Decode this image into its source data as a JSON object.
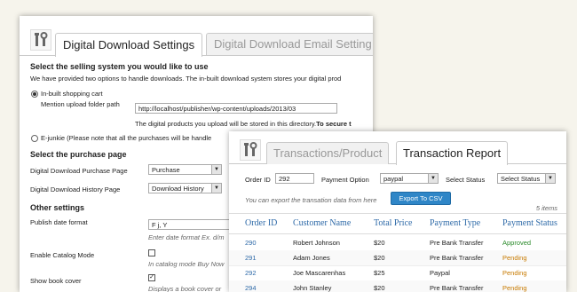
{
  "settings": {
    "tabs": [
      "Digital Download Settings",
      "Digital Download Email Setting"
    ],
    "selling": {
      "heading": "Select the selling system you would like to use",
      "desc": "We have provided two options to handle downloads. The in-built download system stores your digital prod",
      "option_inbuilt": "In-built shopping cart",
      "upload_label": "Mention upload folder path",
      "upload_value": "http://localhost/publisher/wp-content/uploads/2013/03",
      "stored_note": "The digital products you upload will be stored in this directory.",
      "stored_note_bold": "To secure t",
      "option_ejunkie": "E-junkie (Please note that all the purchases will be handle"
    },
    "purchase": {
      "heading": "Select the purchase page",
      "purchase_page_label": "Digital Download Purchase Page",
      "purchase_page_value": "Purchase",
      "history_page_label": "Digital Download History Page",
      "history_page_value": "Download History"
    },
    "other": {
      "heading": "Other settings",
      "date_label": "Publish date format",
      "date_value": "F j, Y",
      "date_hint": "Enter date format Ex. d/m",
      "catalog_label": "Enable Catalog Mode",
      "catalog_hint": "In catalog mode Buy Now",
      "cover_label": "Show book cover",
      "cover_hint": "Displays a book cover or"
    }
  },
  "report": {
    "tabs": [
      "Transactions/Product",
      "Transaction Report"
    ],
    "filters": {
      "order_id_label": "Order ID",
      "order_id_value": "292",
      "payment_option_label": "Payment Option",
      "payment_option_value": "paypal",
      "status_label": "Select Status",
      "status_value": "Select Status"
    },
    "export_note": "You can export the transation data from here",
    "export_button": "Export To CSV",
    "items_count": "5 items",
    "columns": [
      "Order ID",
      "Customer Name",
      "Total Price",
      "Payment Type",
      "Payment Status"
    ],
    "rows": [
      {
        "id": "290",
        "name": "Robert Johnson",
        "price": "$20",
        "type": "Pre Bank Transfer",
        "status": "Approved"
      },
      {
        "id": "291",
        "name": "Adam Jones",
        "price": "$20",
        "type": "Pre Bank Transfer",
        "status": "Pending"
      },
      {
        "id": "292",
        "name": "Joe Mascarenhas",
        "price": "$25",
        "type": "Paypal",
        "status": "Pending"
      },
      {
        "id": "294",
        "name": "John Stanley",
        "price": "$20",
        "type": "Pre Bank Transfer",
        "status": "Pending"
      }
    ]
  }
}
